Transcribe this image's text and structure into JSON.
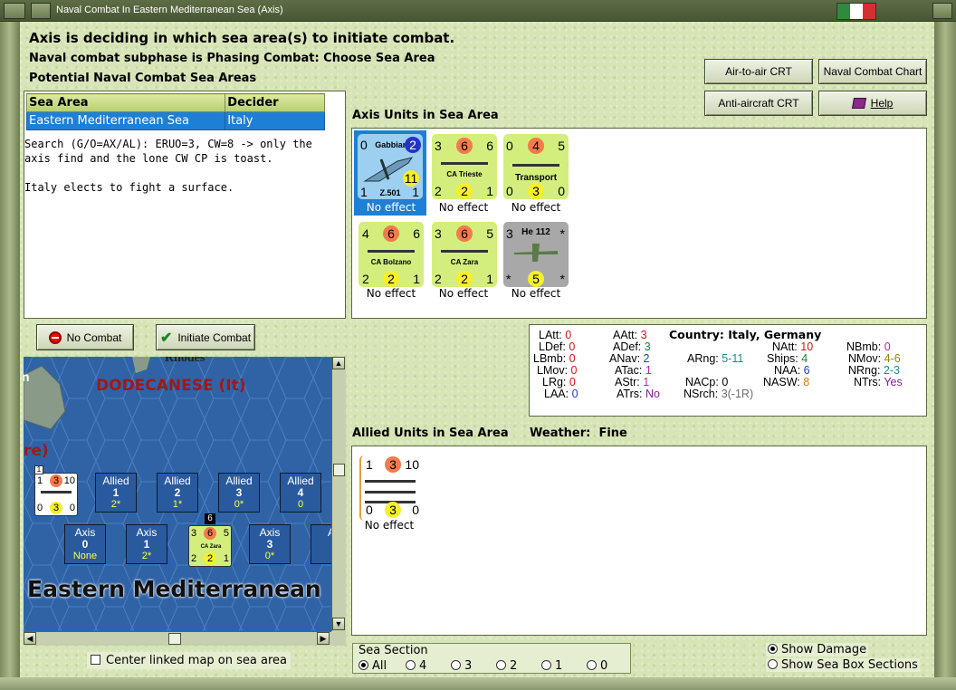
{
  "window": {
    "title": "Naval Combat In Eastern Mediterranean Sea (Axis)",
    "flag_colors": [
      "#2e8b3e",
      "#ffffff",
      "#d43030"
    ]
  },
  "header": {
    "line1": "Axis is deciding in which sea area(s) to initiate combat.",
    "line2": "Naval combat subphase is Phasing Combat: Choose Sea Area",
    "line3": "Potential Naval Combat Sea Areas"
  },
  "buttons": {
    "air_to_air": "Air-to-air CRT",
    "naval_combat_chart": "Naval Combat Chart",
    "anti_aircraft": "Anti-aircraft CRT",
    "help": "Help",
    "no_combat": "No Combat",
    "initiate_combat": "Initiate Combat"
  },
  "sea_table": {
    "headers": [
      "Sea Area",
      "Decider"
    ],
    "rows": [
      {
        "area": "Eastern Mediterranean Sea",
        "decider": "Italy"
      }
    ]
  },
  "log": {
    "line1": "Search (G/O=AX/AL): ERUO=3, CW=8 -> only the",
    "line2": "axis find and the lone CW CP is toast.",
    "line3": "Italy elects to fight a surface."
  },
  "axis_section": {
    "label": "Axis Units in Sea Area",
    "units": [
      {
        "name": "Gabbiano",
        "sub": "Z.501",
        "tl": "0",
        "tr": "2",
        "bl": "1",
        "bm": "11",
        "br": "1",
        "effect": "No effect",
        "color": "#9ccff0"
      },
      {
        "name": "CA Trieste",
        "tl": "3",
        "tm": "6",
        "tr": "6",
        "bl": "2",
        "bm": "2",
        "br": "1",
        "effect": "No effect",
        "color": "#d3ee7d"
      },
      {
        "name": "Transport",
        "tl": "0",
        "tm": "4",
        "tr": "5",
        "bl": "0",
        "bm": "3",
        "br": "0",
        "effect": "No effect",
        "color": "#d3ee7d"
      },
      {
        "name": "CA Bolzano",
        "tl": "4",
        "tm": "6",
        "tr": "6",
        "bl": "2",
        "bm": "2",
        "br": "1",
        "effect": "No effect",
        "color": "#d3ee7d"
      },
      {
        "name": "CA Zara",
        "tl": "3",
        "tm": "6",
        "tr": "5",
        "bl": "2",
        "bm": "2",
        "br": "1",
        "effect": "No effect",
        "color": "#d3ee7d"
      },
      {
        "name": "He 112",
        "tl": "3",
        "tr": "*",
        "bl": "*",
        "bm": "5",
        "br": "*",
        "effect": "No effect",
        "color": "#a8a8a8"
      }
    ]
  },
  "stats": {
    "latt_label": "LAtt:",
    "latt": "0",
    "ldef_label": "LDef:",
    "ldef": "0",
    "lbmb_label": "LBmb:",
    "lbmb": "0",
    "lmov_label": "LMov:",
    "lmov": "0",
    "lrg_label": "LRg:",
    "lrg": "0",
    "laa_label": "LAA:",
    "laa": "0",
    "aatt_label": "AAtt:",
    "aatt": "3",
    "adef_label": "ADef:",
    "adef": "3",
    "anav_label": "ANav:",
    "anav": "2",
    "atac_label": "ATac:",
    "atac": "1",
    "astr_label": "AStr:",
    "astr": "1",
    "atrs_label": "ATrs:",
    "atrs": "No",
    "country_label": "Country:",
    "country": "Italy, Germany",
    "arng_label": "ARng:",
    "arng": "5-11",
    "nacp_label": "NACp:",
    "nacp": "0",
    "nsrch_label": "NSrch:",
    "nsrch": "3(-1R)",
    "natt_label": "NAtt:",
    "natt": "10",
    "ships_label": "Ships:",
    "ships": "4",
    "naa_label": "NAA:",
    "naa": "6",
    "nasw_label": "NASW:",
    "nasw": "8",
    "nbmb_label": "NBmb:",
    "nbmb": "0",
    "nmov_label": "NMov:",
    "nmov": "4-6",
    "nrng_label": "NRng:",
    "nrng": "2-3",
    "ntrs_label": "NTrs:",
    "ntrs": "Yes"
  },
  "map": {
    "rhodes": "Rhodes",
    "dodecanese": "DODECANESE (It)",
    "partial_label": "re)",
    "partial_n": "n",
    "sea_name": "Eastern Mediterranean",
    "allied_boxes": [
      {
        "title": "Allied",
        "num": "1",
        "sub": "2*"
      },
      {
        "title": "Allied",
        "num": "2",
        "sub": "1*"
      },
      {
        "title": "Allied",
        "num": "3",
        "sub": "0*"
      },
      {
        "title": "Allied",
        "num": "4",
        "sub": "0"
      }
    ],
    "axis_boxes": [
      {
        "title": "Axis",
        "num": "0",
        "sub": "None"
      },
      {
        "title": "Axis",
        "num": "1",
        "sub": "2*"
      },
      {
        "title": "Axis",
        "num": "3",
        "sub": "0*"
      },
      {
        "title": "A",
        "num": "",
        "sub": ""
      }
    ],
    "stack_count": "6",
    "map_counter_ally": {
      "tl": "1",
      "tm": "3",
      "tr": "10",
      "bl": "0",
      "bm": "3",
      "br": "0",
      "badge": "1"
    },
    "map_counter_axis": {
      "name": "CA Zara",
      "tl": "3",
      "tm": "6",
      "tr": "5",
      "bl": "2",
      "bm": "2",
      "br": "1"
    }
  },
  "center_map": "Center linked map on sea area",
  "allied_section": {
    "label": "Allied Units in Sea Area",
    "weather_label": "Weather:",
    "weather": "Fine",
    "unit": {
      "tl": "1",
      "tm": "3",
      "tr": "10",
      "bl": "0",
      "bm": "3",
      "br": "0",
      "effect": "No effect"
    }
  },
  "sea_section": {
    "label": "Sea Section",
    "options": [
      "All",
      "4",
      "3",
      "2",
      "1",
      "0"
    ],
    "selected": "All"
  },
  "display_options": {
    "show_damage": "Show Damage",
    "show_sea_box": "Show Sea Box Sections",
    "selected": "Show Damage"
  }
}
